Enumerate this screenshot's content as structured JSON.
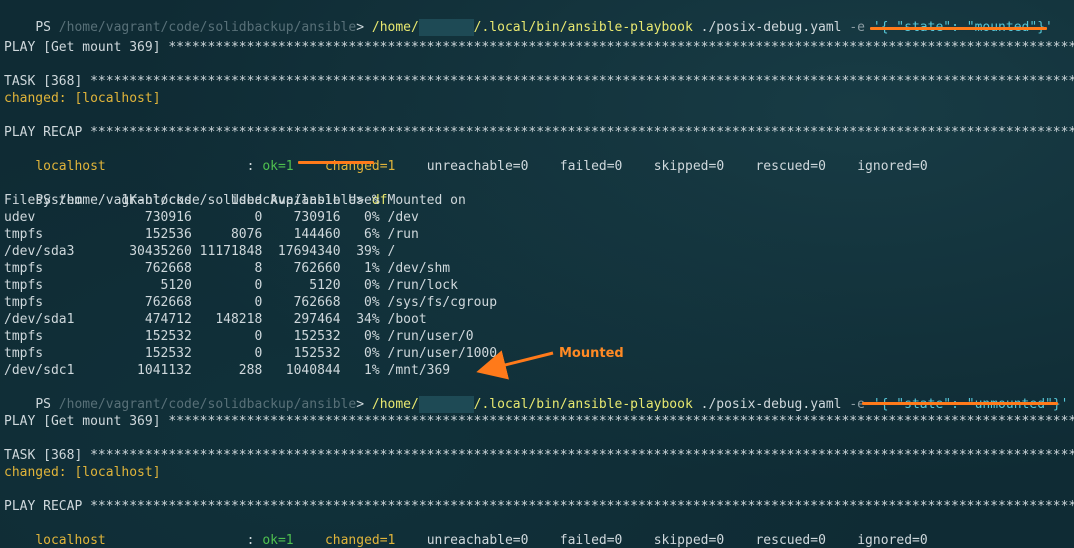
{
  "session1": {
    "prompt_prefix": "PS ",
    "prompt_cwd": "/home/vagrant/code/solidbackup/ansible",
    "prompt_suffix": "> ",
    "cmd_home": "/home/",
    "cmd_rest": "/.local/bin/ansible-playbook",
    "cmd_yaml": " ./posix-debug.yaml",
    "cmd_opt": " -e ",
    "cmd_arg": "'{ \"state\": \"mounted\"}'"
  },
  "run1": {
    "play_header": "PLAY [Get mount 369] ****************************************************************************************************************************************",
    "task_header": "TASK [368] **************************************************************************************************************************************************",
    "task_result": "changed: [localhost]",
    "recap_header": "PLAY RECAP **************************************************************************************************************************************************",
    "recap_host": "localhost",
    "recap_sep": "                  : ",
    "recap_ok": "ok=1",
    "recap_changed": "changed=1",
    "recap_unreachable": "unreachable=0",
    "recap_failed": "failed=0",
    "recap_skipped": "skipped=0",
    "recap_rescued": "rescued=0",
    "recap_ignored": "ignored=0"
  },
  "df_prompt": {
    "prompt": "PS /home/vagrant/code/solidbackup/ansible> ",
    "cmd": "df"
  },
  "df_table": {
    "header": "Filesystem     1K-blocks     Used Available Use% Mounted on",
    "rows": [
      "udev              730916        0    730916   0% /dev",
      "tmpfs             152536     8076    144460   6% /run",
      "/dev/sda3       30435260 11171848  17694340  39% /",
      "tmpfs             762668        8    762660   1% /dev/shm",
      "tmpfs               5120        0      5120   0% /run/lock",
      "tmpfs             762668        0    762668   0% /sys/fs/cgroup",
      "/dev/sda1         474712   148218    297464  34% /boot",
      "tmpfs             152532        0    152532   0% /run/user/0",
      "tmpfs             152532        0    152532   0% /run/user/1000",
      "/dev/sdc1        1041132      288   1040844   1% /mnt/369"
    ]
  },
  "session2": {
    "prompt_prefix": "PS ",
    "prompt_cwd": "/home/vagrant/code/solidbackup/ansible",
    "prompt_suffix": "> ",
    "cmd_home": "/home/",
    "cmd_rest": "/.local/bin/ansible-playbook",
    "cmd_yaml": " ./posix-debug.yaml",
    "cmd_opt": " -e ",
    "cmd_arg": "'{ \"state\": \"unmounted\"}'"
  },
  "run2": {
    "play_header": "PLAY [Get mount 369] ****************************************************************************************************************************************",
    "task_header": "TASK [368] **************************************************************************************************************************************************",
    "task_result": "changed: [localhost]",
    "recap_header": "PLAY RECAP **************************************************************************************************************************************************",
    "recap_host": "localhost",
    "recap_sep": "                  : ",
    "recap_ok": "ok=1",
    "recap_changed": "changed=1",
    "recap_unreachable": "unreachable=0",
    "recap_failed": "failed=0",
    "recap_skipped": "skipped=0",
    "recap_rescued": "rescued=0",
    "recap_ignored": "ignored=0"
  },
  "annotation": {
    "label": "Mounted",
    "color": "#ff7a1a"
  },
  "colors": {
    "background": "#0f2b34",
    "text": "#cfd8dc",
    "command": "#e8e870",
    "string": "#56c6d6",
    "changed": "#e0b43a",
    "ok": "#4fc04f",
    "highlight": "#ff7a1a"
  }
}
